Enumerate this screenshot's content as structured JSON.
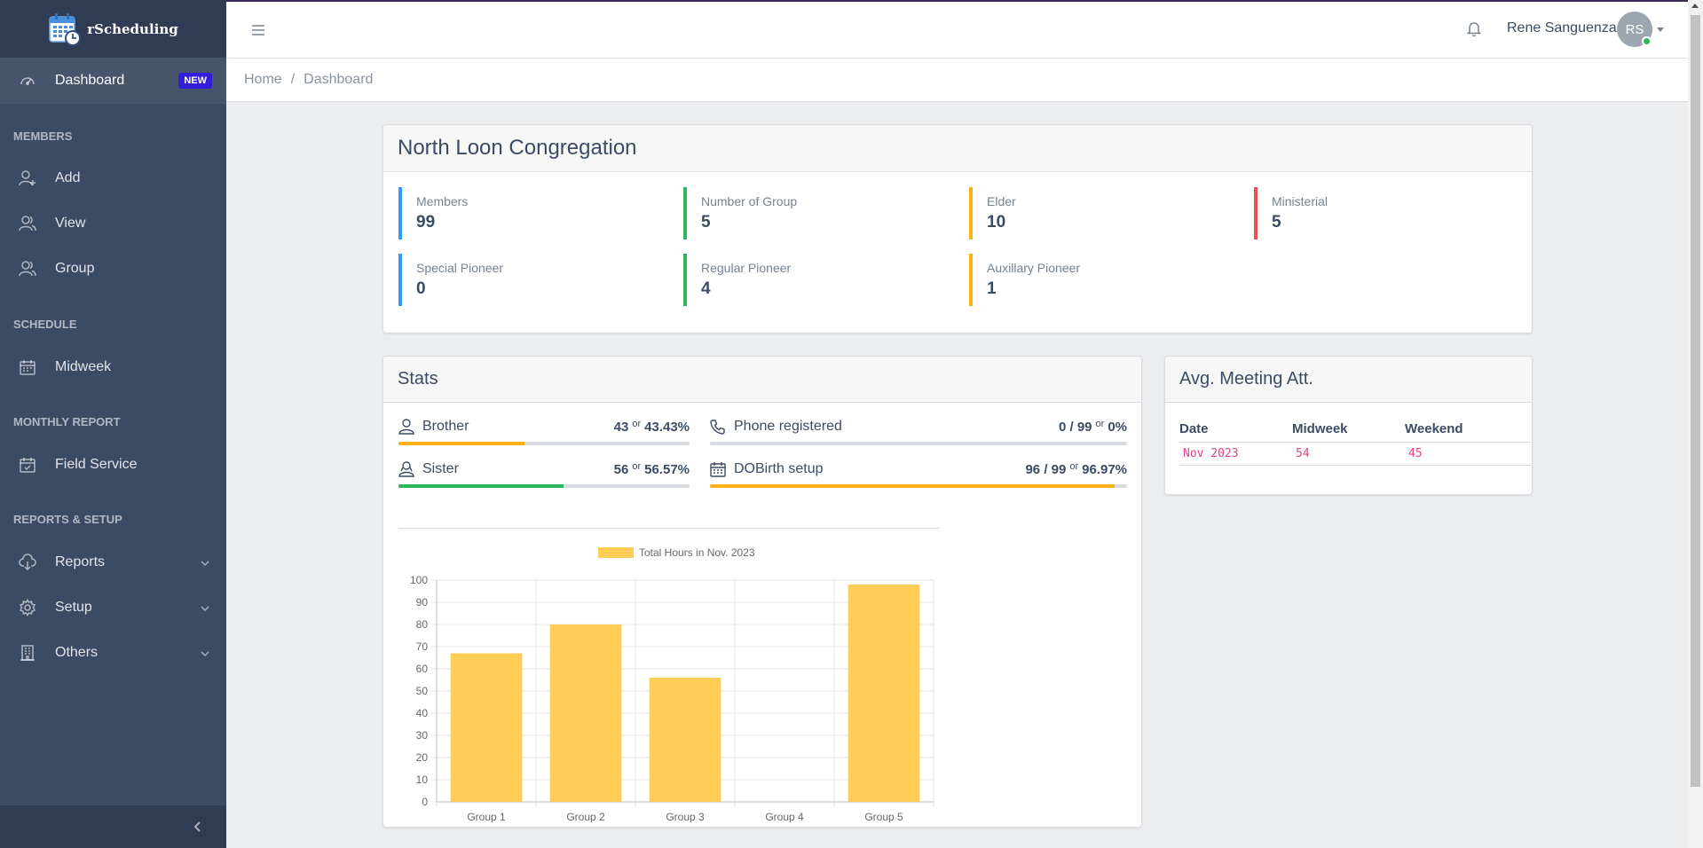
{
  "app": {
    "brand": "rScheduling"
  },
  "sidebar": {
    "dashboard": {
      "label": "Dashboard",
      "badge": "NEW"
    },
    "sections": {
      "members": "MEMBERS",
      "schedule": "SCHEDULE",
      "monthly_report": "MONTHLY REPORT",
      "reports_setup": "REPORTS & SETUP"
    },
    "items": {
      "add": "Add",
      "view": "View",
      "group": "Group",
      "midweek": "Midweek",
      "field_service": "Field Service",
      "reports": "Reports",
      "setup": "Setup",
      "others": "Others"
    }
  },
  "header": {
    "user_name": "Rene Sanguenza",
    "avatar_initials": "RS"
  },
  "breadcrumb": {
    "home": "Home",
    "separator": "/",
    "current": "Dashboard"
  },
  "congregation": {
    "title": "North Loon Congregation",
    "callouts": [
      {
        "label": "Members",
        "value": "99",
        "color": "#39f"
      },
      {
        "label": "Number of Group",
        "value": "5",
        "color": "#2eb85c"
      },
      {
        "label": "Elder",
        "value": "10",
        "color": "#f9b115"
      },
      {
        "label": "Ministerial",
        "value": "5",
        "color": "#e55353"
      },
      {
        "label": "Special Pioneer",
        "value": "0",
        "color": "#39f"
      },
      {
        "label": "Regular Pioneer",
        "value": "4",
        "color": "#2eb85c"
      },
      {
        "label": "Auxillary Pioneer",
        "value": "1",
        "color": "#f9b115"
      }
    ]
  },
  "stats": {
    "title": "Stats",
    "brother": {
      "label": "Brother",
      "count": "43",
      "or": "or",
      "percent": "43.43%",
      "progress": 43.43,
      "color": "#f9b115"
    },
    "sister": {
      "label": "Sister",
      "count": "56",
      "or": "or",
      "percent": "56.57%",
      "progress": 56.57,
      "color": "#2eb85c"
    },
    "phone": {
      "label": "Phone registered",
      "count": "0 / 99",
      "or": "or",
      "percent": "0%",
      "progress": 0,
      "color": "#39f"
    },
    "dob": {
      "label": "DOBirth setup",
      "count": "96 / 99",
      "or": "or",
      "percent": "96.97%",
      "progress": 96.97,
      "color": "#f9b115"
    }
  },
  "attendance": {
    "title": "Avg. Meeting Att.",
    "headers": [
      "Date",
      "Midweek",
      "Weekend"
    ],
    "rows": [
      [
        "Nov 2023",
        "54",
        "45"
      ]
    ]
  },
  "chart_data": {
    "type": "bar",
    "categories": [
      "Group 1",
      "Group 2",
      "Group 3",
      "Group 4",
      "Group 5"
    ],
    "series": [
      {
        "name": "Total Hours in Nov. 2023",
        "values": [
          67,
          80,
          56,
          0,
          98
        ]
      }
    ],
    "ylim": [
      0,
      100
    ],
    "yticks": [
      0,
      10,
      20,
      30,
      40,
      50,
      60,
      70,
      80,
      90,
      100
    ],
    "legend": "top",
    "grid": true,
    "bar_color": "#ffcd56"
  }
}
